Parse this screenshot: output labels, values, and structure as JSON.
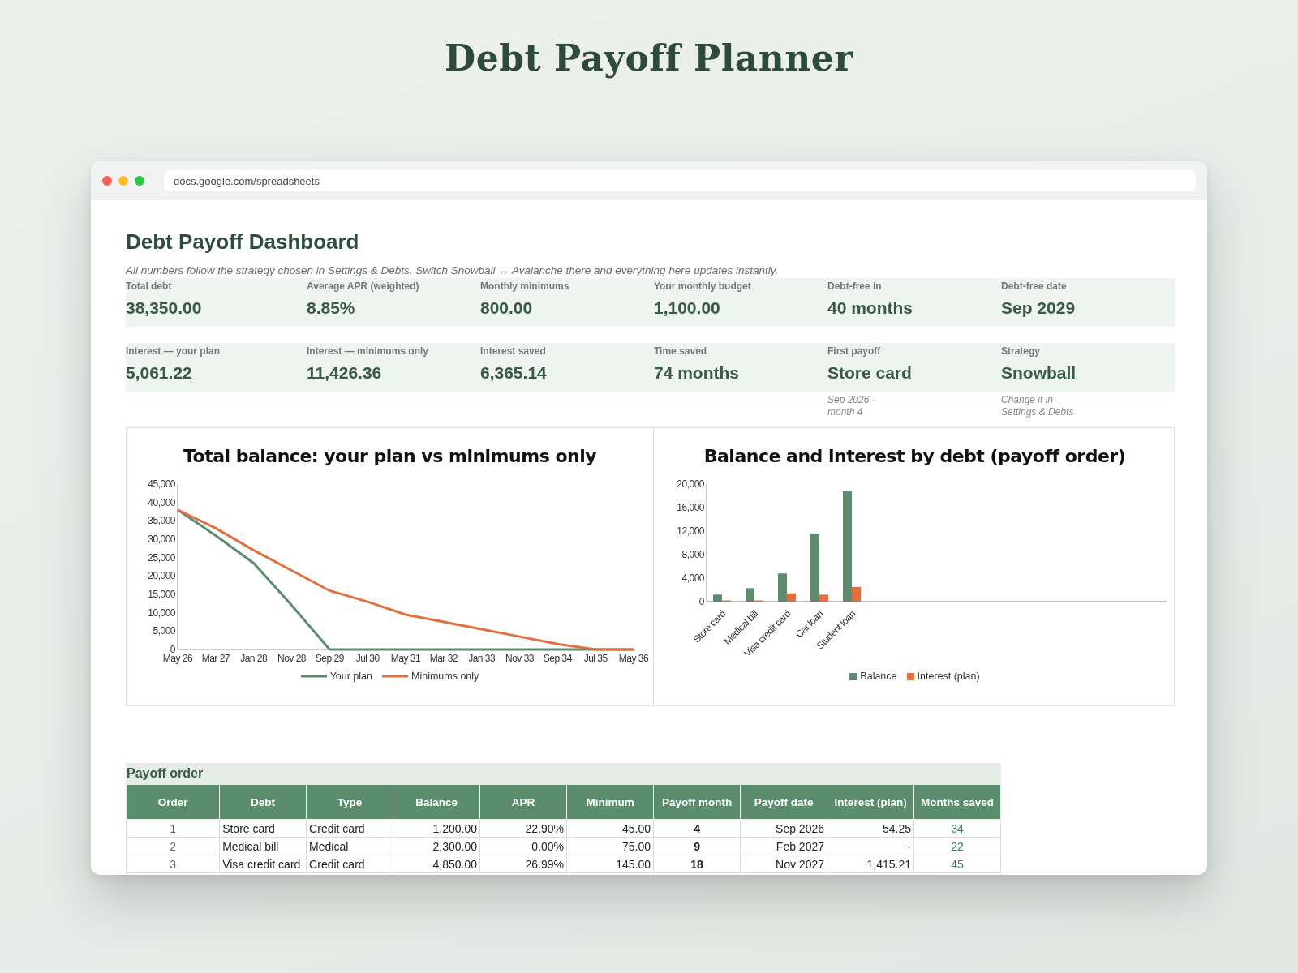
{
  "page_title": "Debt Payoff Planner",
  "browser": {
    "url": "docs.google.com/spreadsheets"
  },
  "dashboard": {
    "title": "Debt Payoff Dashboard",
    "subtitle": "All numbers follow the strategy chosen in Settings & Debts. Switch Snowball ↔ Avalanche there and everything here updates instantly.",
    "kpi_rows": [
      [
        {
          "label": "Total debt",
          "value": "38,350.00"
        },
        {
          "label": "Average APR (weighted)",
          "value": "8.85%"
        },
        {
          "label": "Monthly minimums",
          "value": "800.00"
        },
        {
          "label": "Your monthly budget",
          "value": "1,100.00"
        },
        {
          "label": "Debt-free in",
          "value": "40 months"
        },
        {
          "label": "Debt-free date",
          "value": "Sep 2029"
        }
      ],
      [
        {
          "label": "Interest — your plan",
          "value": "5,061.22"
        },
        {
          "label": "Interest — minimums only",
          "value": "11,426.36"
        },
        {
          "label": "Interest saved",
          "value": "6,365.14"
        },
        {
          "label": "Time saved",
          "value": "74 months"
        },
        {
          "label": "First payoff",
          "value": "Store card",
          "note": [
            "Sep 2026 ·",
            "month 4"
          ]
        },
        {
          "label": "Strategy",
          "value": "Snowball",
          "note": [
            "Change it in",
            "Settings & Debts"
          ]
        }
      ]
    ]
  },
  "charts": [
    {
      "chart_data": {
        "type": "line",
        "title": "Total balance: your plan vs minimums only",
        "categories": [
          "May 26",
          "Mar 27",
          "Jan 28",
          "Nov 28",
          "Sep 29",
          "Jul 30",
          "May 31",
          "Mar 32",
          "Jan 33",
          "Nov 33",
          "Sep 34",
          "Jul 35",
          "May 36"
        ],
        "series": [
          {
            "name": "Your plan",
            "color": "#5b8c6e",
            "values": [
              38000,
              31000,
              23500,
              12000,
              0,
              0,
              0,
              0,
              0,
              0,
              0,
              0,
              0
            ]
          },
          {
            "name": "Minimums only",
            "color": "#e0703f",
            "values": [
              38000,
              33000,
              27000,
              21500,
              16000,
              13000,
              9500,
              7500,
              5500,
              3500,
              1500,
              0,
              0
            ]
          }
        ],
        "ylim": [
          0,
          45000
        ],
        "yticks": [
          {
            "value": 0,
            "label": "0"
          },
          {
            "value": 5000,
            "label": "5,000"
          },
          {
            "value": 10000,
            "label": "10,000"
          },
          {
            "value": 15000,
            "label": "15,000"
          },
          {
            "value": 20000,
            "label": "20,000"
          },
          {
            "value": 25000,
            "label": "25,000"
          },
          {
            "value": 30000,
            "label": "30,000"
          },
          {
            "value": 35000,
            "label": "35,000"
          },
          {
            "value": 40000,
            "label": "40,000"
          },
          {
            "value": 45000,
            "label": "45,000"
          }
        ]
      }
    },
    {
      "chart_data": {
        "type": "bar",
        "title": "Balance and interest by debt (payoff order)",
        "categories": [
          "Store card",
          "Medical bill",
          "Visa credit card",
          "Car loan",
          "Student loan"
        ],
        "series": [
          {
            "name": "Balance",
            "color": "#5b8c6e",
            "values": [
              1200,
              2300,
              4800,
              11600,
              18800
            ]
          },
          {
            "name": "Interest (plan)",
            "color": "#e0703f",
            "values": [
              100,
              0,
              1400,
              1200,
              2500
            ]
          }
        ],
        "ylim": [
          0,
          20000
        ],
        "yticks": [
          {
            "value": 0,
            "label": "0"
          },
          {
            "value": 4000,
            "label": "4,000"
          },
          {
            "value": 8000,
            "label": "8,000"
          },
          {
            "value": 12000,
            "label": "12,000"
          },
          {
            "value": 16000,
            "label": "16,000"
          },
          {
            "value": 20000,
            "label": "20,000"
          }
        ]
      }
    }
  ],
  "payoff_table": {
    "title": "Payoff order",
    "columns": [
      "Order",
      "Debt",
      "Type",
      "Balance",
      "APR",
      "Minimum",
      "Payoff month",
      "Payoff date",
      "Interest (plan)",
      "Months saved"
    ],
    "rows": [
      [
        "1",
        "Store card",
        "Credit card",
        "1,200.00",
        "22.90%",
        "45.00",
        "4",
        "Sep 2026",
        "54.25",
        "34"
      ],
      [
        "2",
        "Medical bill",
        "Medical",
        "2,300.00",
        "0.00%",
        "75.00",
        "9",
        "Feb 2027",
        "-",
        "22"
      ],
      [
        "3",
        "Visa credit card",
        "Credit card",
        "4,850.00",
        "26.99%",
        "145.00",
        "18",
        "Nov 2027",
        "1,415.21",
        "45"
      ]
    ]
  }
}
